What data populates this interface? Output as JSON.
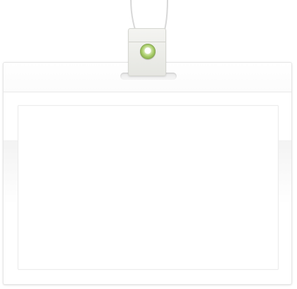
{
  "badge": {
    "type": "id-badge-holder",
    "lanyard_color": "#d9d9d9",
    "clip_color": "#e8e9e4",
    "eyelet_color": "#a9cd6b",
    "card_text": ""
  }
}
